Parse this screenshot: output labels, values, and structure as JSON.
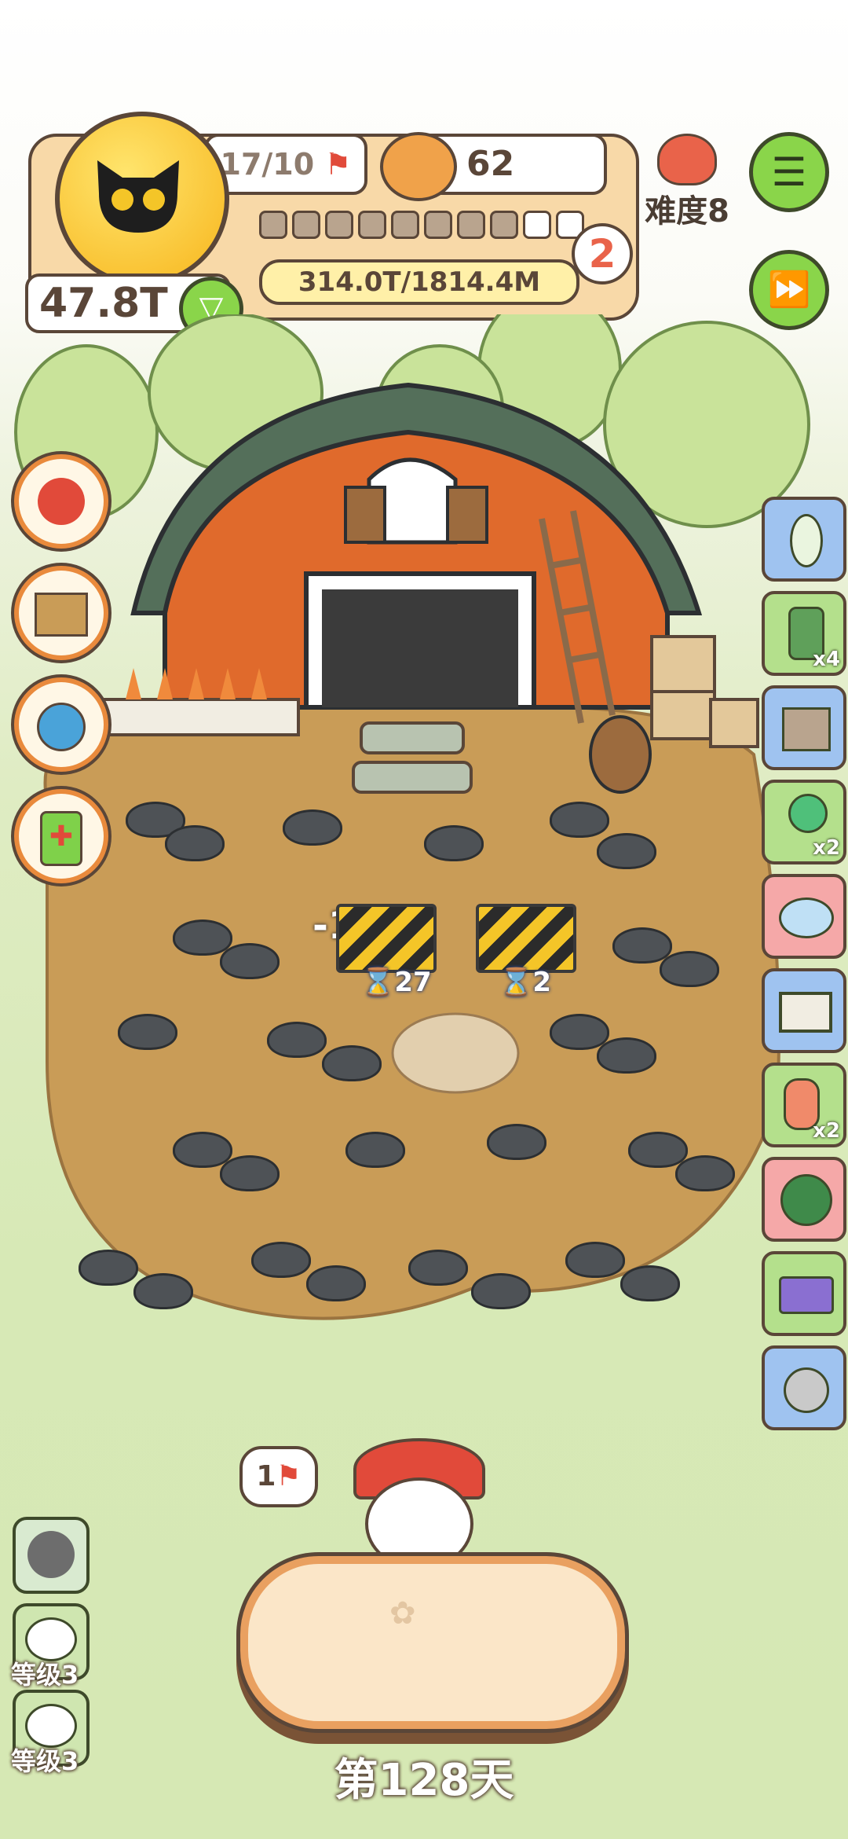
{
  "header": {
    "flag_count": "17/10",
    "bowl_count": "62",
    "difficulty": "难度8",
    "currency": "47.8T",
    "level_number": "2",
    "progress_text": "314.0T/1814.4M",
    "progress_segments_filled": 8,
    "progress_segments_total": 10
  },
  "field": {
    "damage_popup": "-1",
    "barrier_timers": [
      "27",
      "2"
    ]
  },
  "right_items": [
    {
      "icon": "leaf-icon",
      "badge": "",
      "color": "#9fc3f0"
    },
    {
      "icon": "potion-bottle-icon",
      "badge": "x4",
      "color": "#b4e08c"
    },
    {
      "icon": "machine-icon",
      "badge": "",
      "color": "#9fc3f0"
    },
    {
      "icon": "lollipop-icon",
      "badge": "x2",
      "color": "#b4e08c"
    },
    {
      "icon": "cloud-creature-icon",
      "badge": "",
      "color": "#f5a8a8"
    },
    {
      "icon": "frame-icon",
      "badge": "",
      "color": "#9fc3f0"
    },
    {
      "icon": "worm-icon",
      "badge": "x2",
      "color": "#b4e08c"
    },
    {
      "icon": "green-ball-icon",
      "badge": "",
      "color": "#f5a8a8"
    },
    {
      "icon": "card-icon",
      "badge": "",
      "color": "#b4e08c"
    },
    {
      "icon": "wind-up-mouse-icon",
      "badge": "",
      "color": "#9fc3f0"
    }
  ],
  "bottom": {
    "speech_count": "1",
    "level_labels": [
      "等级3",
      "等级3"
    ],
    "day_label": "第128天"
  }
}
